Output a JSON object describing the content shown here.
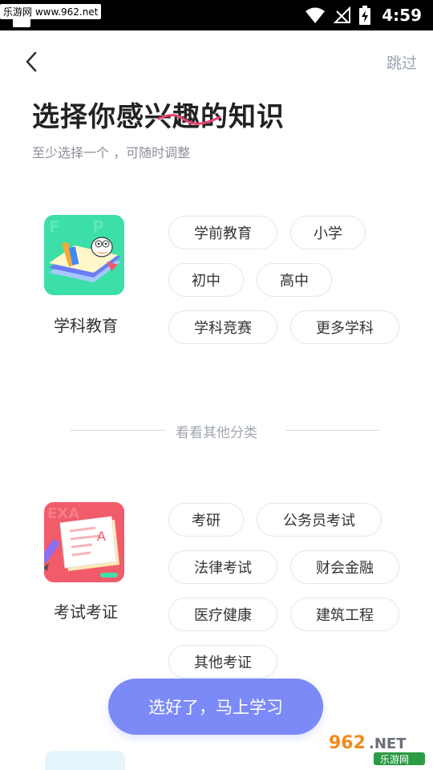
{
  "status_bar": {
    "watermark": "乐游网 www.962.net",
    "time": "4:59"
  },
  "header": {
    "back_icon": "chevron-left-icon",
    "skip_label": "跳过",
    "title": "选择你感兴趣的知识",
    "subtitle": "至少选择一个 ，可随时调整"
  },
  "sections": [
    {
      "label": "学科教育",
      "icon": "book-duck-icon",
      "tags": [
        "学前教育",
        "小学",
        "初中",
        "高中",
        "学科竞赛",
        "更多学科"
      ]
    },
    {
      "label": "考试考证",
      "icon": "exam-paper-icon",
      "tags": [
        "考研",
        "公务员考试",
        "法律考试",
        "财会金融",
        "医疗健康",
        "建筑工程",
        "其他考证"
      ]
    }
  ],
  "divider_label": "看看其他分类",
  "cta_label": "选好了，马上学习",
  "watermark_bottom": {
    "brand": "962.NET",
    "name": "乐游网"
  },
  "colors": {
    "accent": "#7b8af7",
    "title_underline": "#e8436d",
    "section1_icon_bg": "#3ddfa8",
    "section2_icon_bg": "#f25b6a"
  }
}
